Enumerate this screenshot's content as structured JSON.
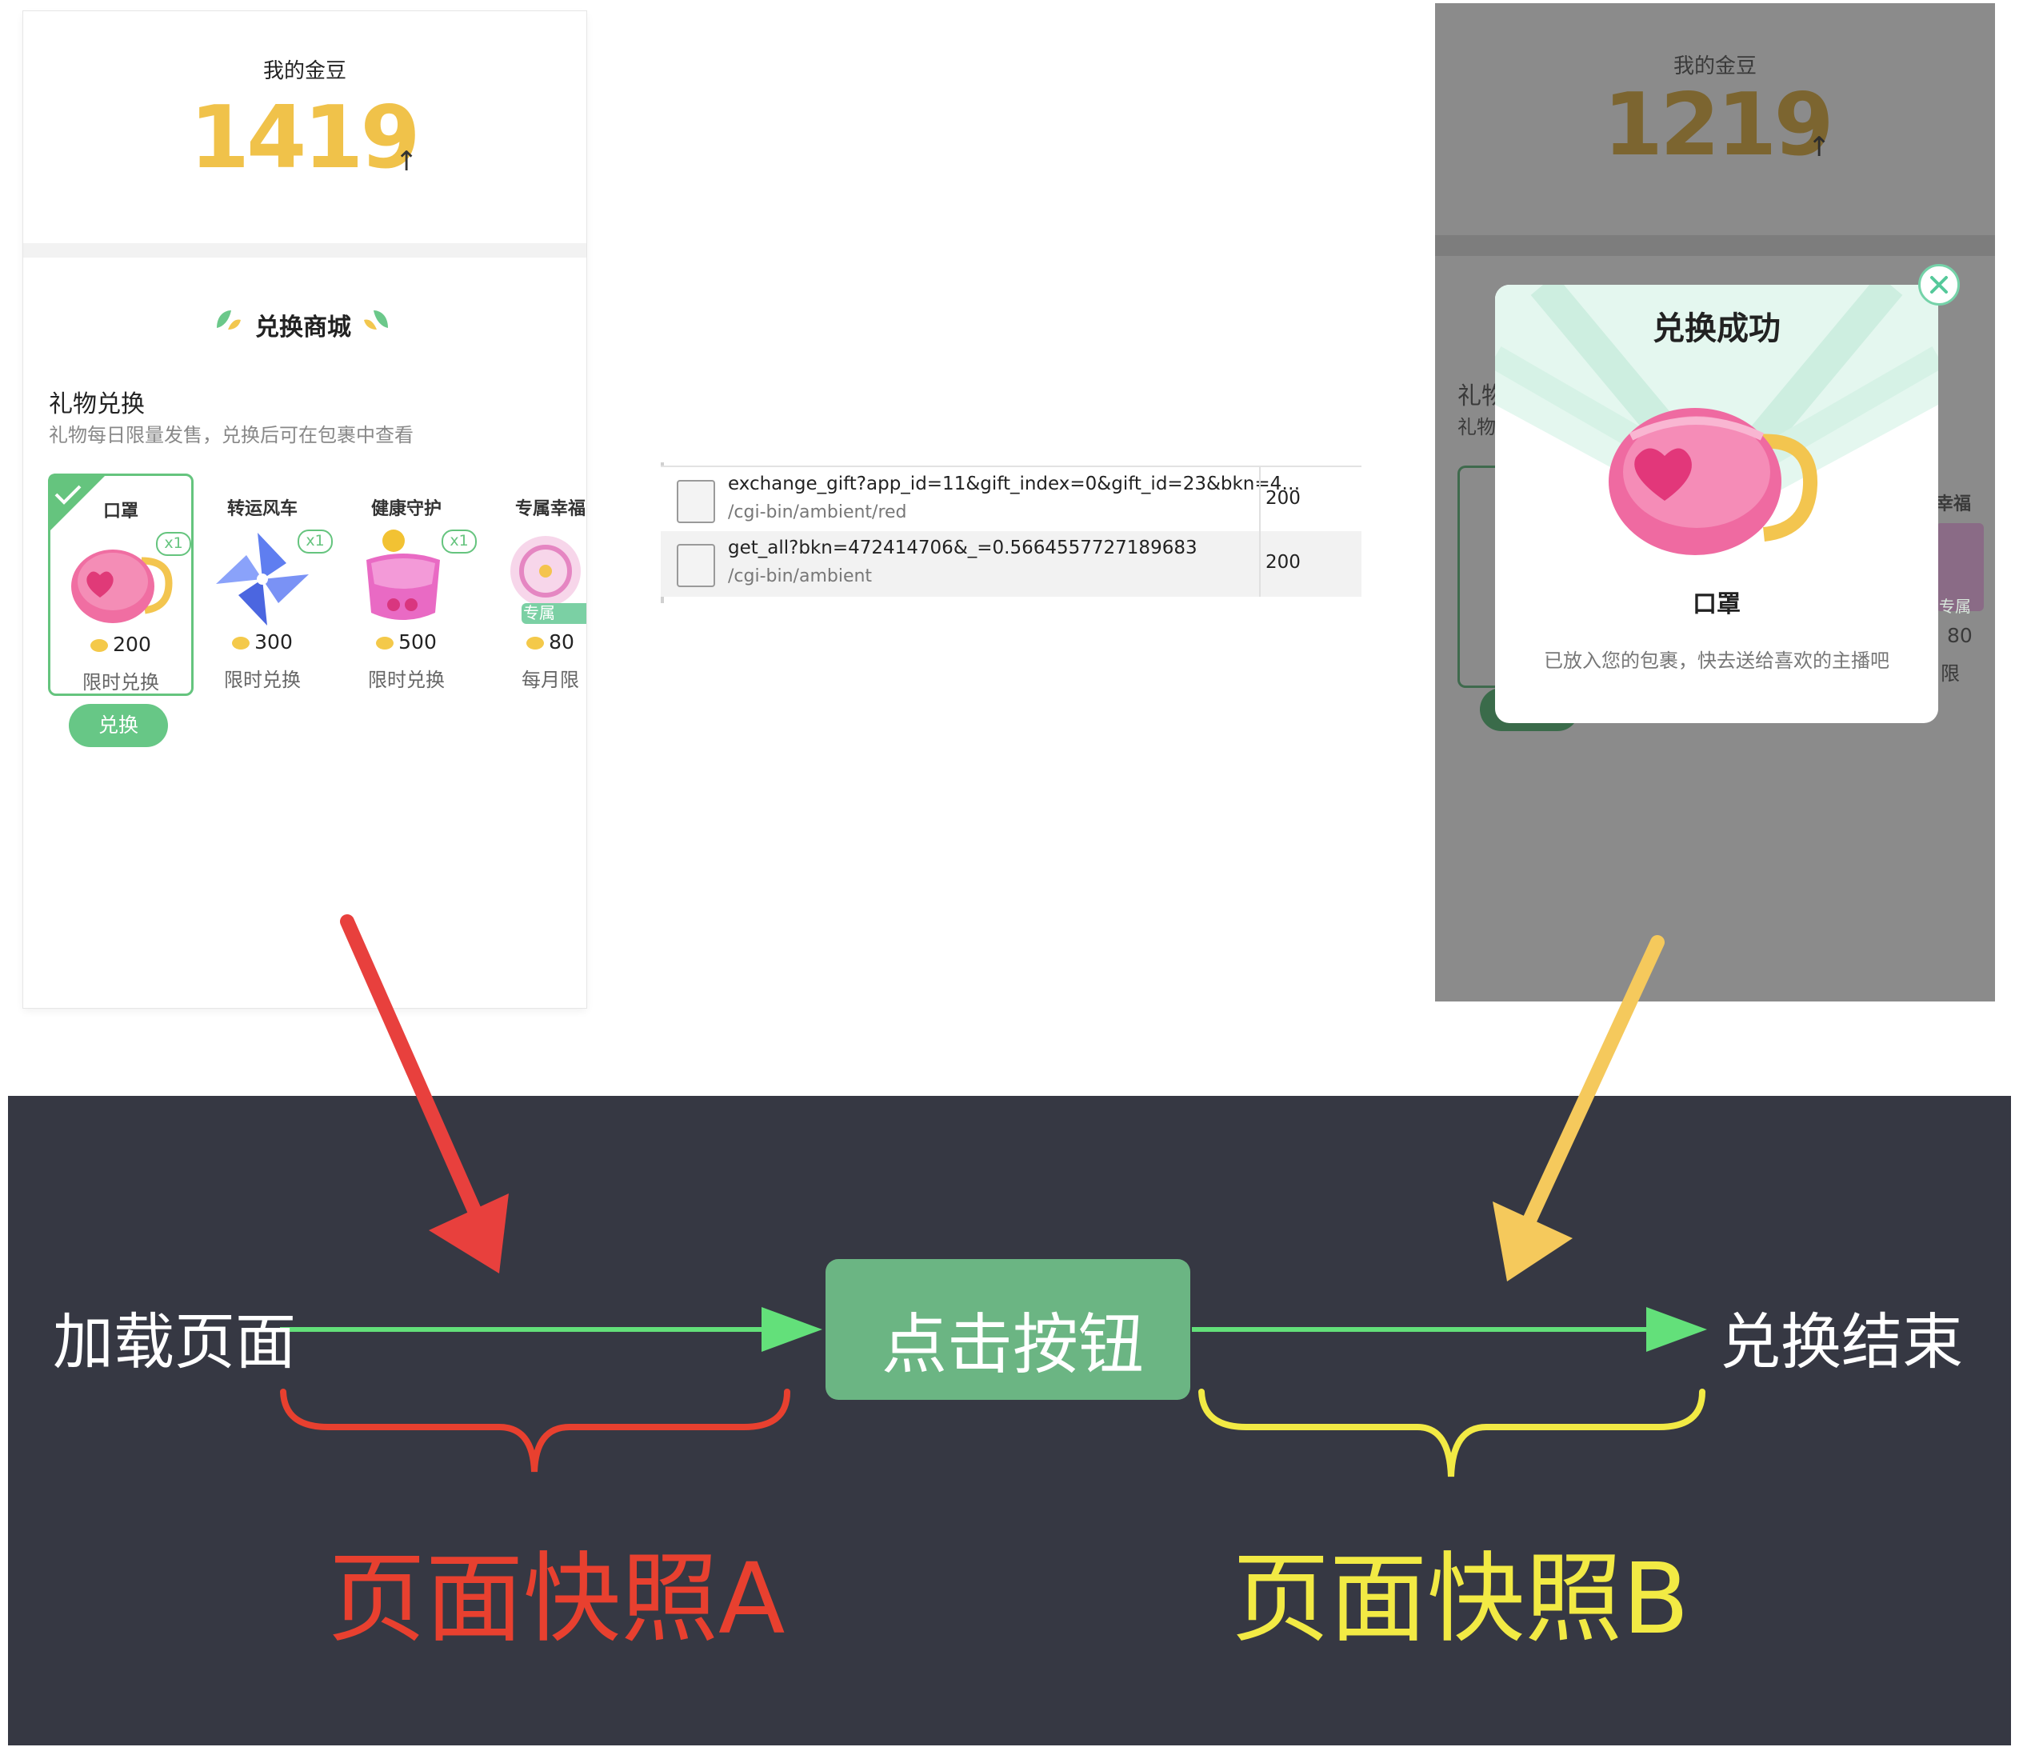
{
  "snapshot_a": {
    "bean_label": "我的金豆",
    "bean_count": "1419",
    "bean_arrow": "↑",
    "mall_title": "兑换商城",
    "section_title": "礼物兑换",
    "section_subtitle": "礼物每日限量发售，兑换后可在包裹中查看",
    "gifts": [
      {
        "name": "口罩",
        "badge": "x1",
        "price": "200",
        "limit": "限时兑换",
        "selected": true
      },
      {
        "name": "转运风车",
        "badge": "x1",
        "price": "300",
        "limit": "限时兑换",
        "selected": false
      },
      {
        "name": "健康守护",
        "badge": "x1",
        "price": "500",
        "limit": "限时兑换",
        "selected": false
      },
      {
        "name": "专属幸福",
        "badge": "专属",
        "price": "80",
        "limit": "每月限",
        "selected": false
      }
    ],
    "exchange_button": "兑换"
  },
  "network": {
    "rows": [
      {
        "url": "exchange_gift?app_id=11&gift_index=0&gift_id=23&bkn=4…",
        "path": "/cgi-bin/ambient/red",
        "status": "200"
      },
      {
        "url": "get_all?bkn=472414706&_=0.5664557727189683",
        "path": "/cgi-bin/ambient",
        "status": "200"
      }
    ]
  },
  "snapshot_b": {
    "bean_label": "我的金豆",
    "bean_count": "1219",
    "bean_arrow": "↑",
    "behind_title": "礼物",
    "behind_sub": "礼物",
    "behind_right_title": "幸福",
    "behind_right_price": "80",
    "behind_right_limit": "限",
    "behind_right_tag": "专属",
    "modal": {
      "title": "兑换成功",
      "gift_name": "口罩",
      "description": "已放入您的包裹，快去送给喜欢的主播吧",
      "close_icon": "close-icon"
    }
  },
  "flow": {
    "start": "加载页面",
    "action": "点击按钮",
    "end": "兑换结束",
    "label_a": "页面快照A",
    "label_b": "页面快照B",
    "colors": {
      "background": "#363843",
      "line": "#63e07a",
      "button": "#6bb583",
      "arrow_a": "#e8403d",
      "arrow_b": "#f5c95c",
      "brace_a": "#e8402f",
      "brace_b": "#f2ea44",
      "label_a": "#e8402f",
      "label_b": "#f2ea44"
    }
  }
}
